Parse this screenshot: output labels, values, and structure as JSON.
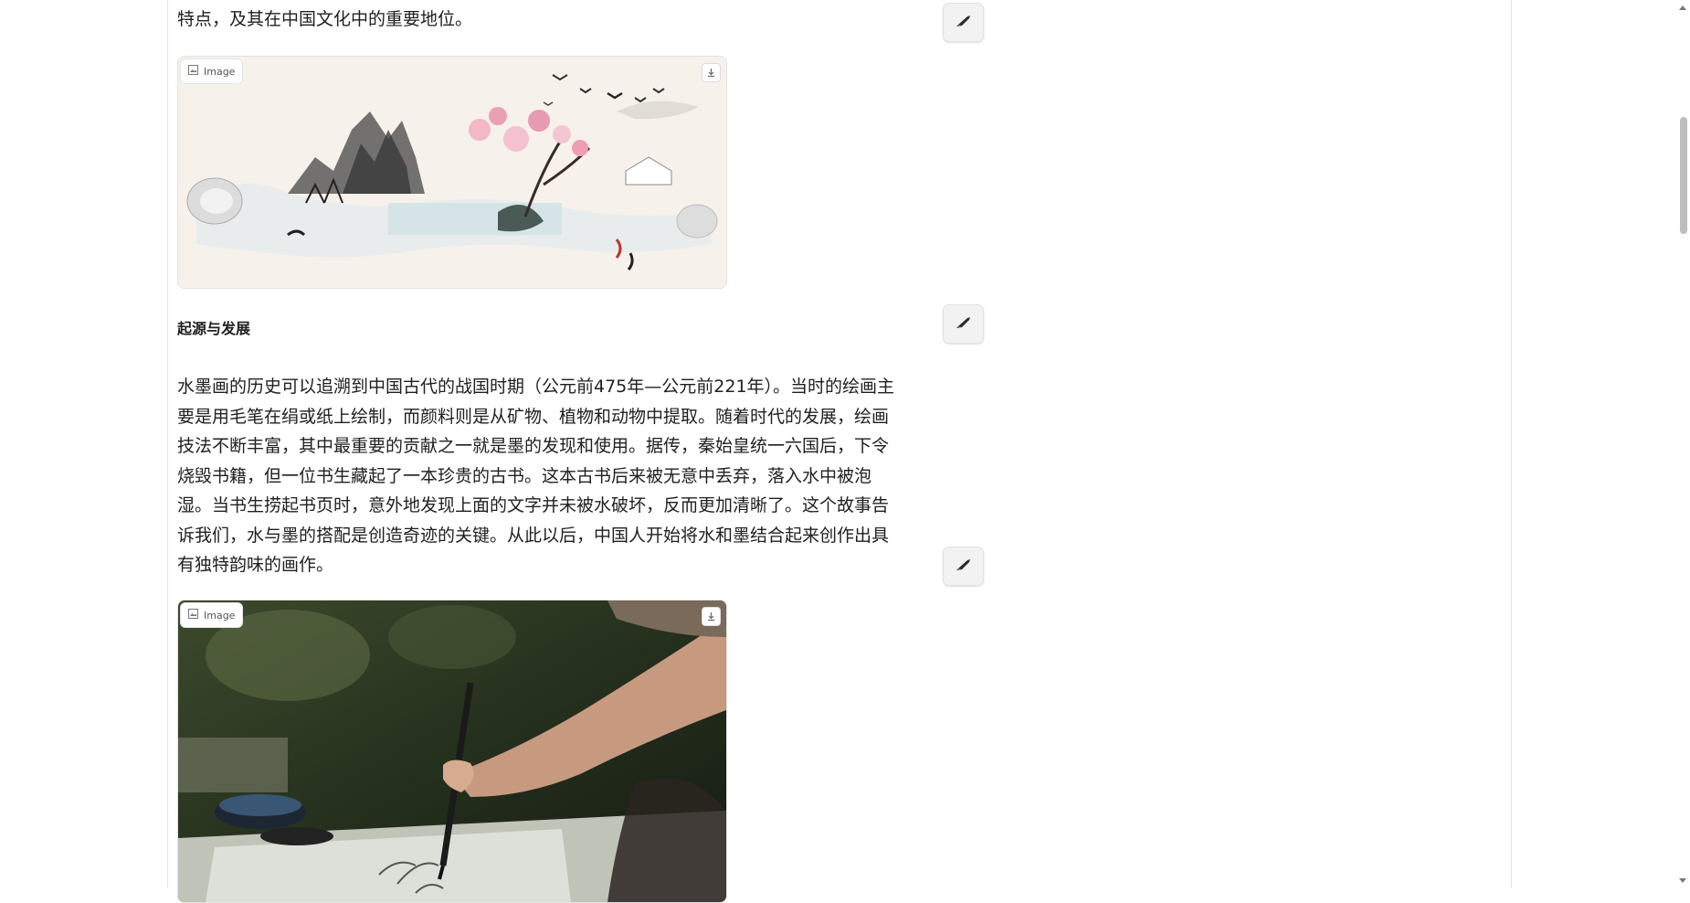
{
  "article": {
    "intro_tail": "特点，及其在中国文化中的重要地位。",
    "section_heading": "起源与发展",
    "paragraph_lines": [
      "水墨画的历史可以追溯到中国古代的战国时期（公元前475年—公元前221年）。当时的绘画主",
      "要是用毛笔在绢或纸上绘制，而颜料则是从矿物、植物和动物中提取。随着时代的发展，绘画",
      "技法不断丰富，其中最重要的贡献之一就是墨的发现和使用。据传，秦始皇统一六国后，下令",
      "烧毁书籍，但一位书生藏起了一本珍贵的古书。这本古书后来被无意中丢弃，落入水中被泡",
      "湿。当书生捞起书页时，意外地发现上面的文字并未被水破坏，反而更加清晰了。这个故事告",
      "诉我们，水与墨的搭配是创造奇迹的关键。从此以后，中国人开始将水和墨结合起来创作出具",
      "有独特韵味的画作。"
    ]
  },
  "images": [
    {
      "badge_label": "Image",
      "badge_icon": "image-icon",
      "download_icon": "download-icon"
    },
    {
      "badge_label": "Image",
      "badge_icon": "image-icon",
      "download_icon": "download-icon"
    }
  ],
  "edit_button_icon": "brush-icon",
  "colors": {
    "accent_ink": "#2b2b2b",
    "panel_border": "#e4e4e4",
    "button_bg": "#f2f2f2"
  }
}
